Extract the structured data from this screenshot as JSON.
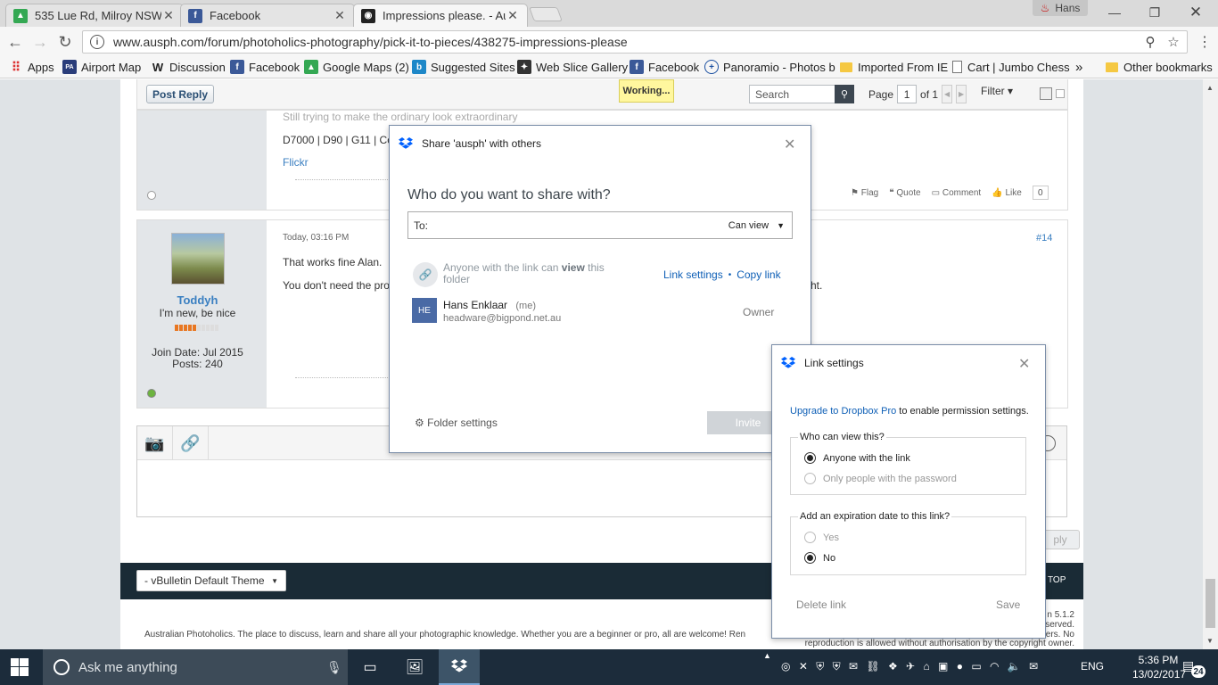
{
  "browser": {
    "tabs": [
      {
        "title": "535 Lue Rd, Milroy NSW",
        "favicon": "google-maps-icon"
      },
      {
        "title": "Facebook",
        "favicon": "facebook-icon"
      },
      {
        "title": "Impressions please. - Aus",
        "favicon": "ausph-icon"
      }
    ],
    "profile_name": "Hans",
    "url": "www.ausph.com/forum/photoholics-photography/pick-it-to-pieces/438275-impressions-please",
    "bookmarks": [
      "Apps",
      "Airport Map",
      "Discussion",
      "Facebook",
      "Google Maps (2)",
      "Suggested Sites",
      "Web Slice Gallery",
      "Facebook",
      "Panoramio - Photos b",
      "Imported From IE",
      "Cart | Jumbo Chess"
    ],
    "overflow": "»",
    "other_bookmarks": "Other bookmarks"
  },
  "forum": {
    "post_reply": "Post Reply",
    "working": "Working...",
    "search_placeholder": "Search",
    "page_label": "Page",
    "page_num": "1",
    "page_of": "of 1",
    "filter": "Filter",
    "post1": {
      "sig_faint": "Still trying to make the ordinary look extraordinary",
      "gear": "D7000 | D90 | G11 | Co",
      "flickr": "Flickr",
      "actions": [
        "Flag",
        "Quote",
        "Comment",
        "Like"
      ],
      "like_count": "0"
    },
    "post2": {
      "date": "Today, 03:16 PM",
      "number": "#14",
      "username": "Toddyh",
      "title": "I'm new, be nice",
      "join": "Join Date: Jul 2015",
      "posts": "Posts: 240",
      "line1": "That works fine Alan.",
      "line2_start": "You don't need the pro",
      "line2_end": "ht."
    },
    "reply_ghost": "ply",
    "theme": "- vBulletin Default Theme",
    "top": "TOP",
    "footer": "Australian Photoholics. The place to discuss, learn and share all your photographic knowledge. Whether you are a beginner or pro, all are welcome! Ren",
    "copyright_lines": [
      "n 5.1.2",
      "served.",
      "ers. No",
      "reproduction is allowed without authorisation by the copyright owner."
    ]
  },
  "share_dialog": {
    "title": "Share 'ausph' with others",
    "question": "Who do you want to share with?",
    "to_label": "To:",
    "permission": "Can view",
    "anyone_pre": "Anyone with the link can",
    "anyone_bold": "view",
    "anyone_post": "this folder",
    "link_settings": "Link settings",
    "separator": "•",
    "copy_link": "Copy link",
    "owner_initials": "HE",
    "owner_name": "Hans Enklaar",
    "owner_me": "(me)",
    "owner_email": "headware@bigpond.net.au",
    "owner_role": "Owner",
    "folder_settings": "Folder settings",
    "invite": "Invite"
  },
  "link_settings_dialog": {
    "title": "Link settings",
    "upgrade_link": "Upgrade to Dropbox Pro",
    "upgrade_rest": " to enable permission settings.",
    "who_legend": "Who can view this?",
    "opt_anyone": "Anyone with the link",
    "opt_password": "Only people with the password",
    "expiry_legend": "Add an expiration date to this link?",
    "opt_yes": "Yes",
    "opt_no": "No",
    "delete": "Delete link",
    "save": "Save"
  },
  "taskbar": {
    "search": "Ask me anything",
    "lang": "ENG",
    "time": "5:36 PM",
    "date": "13/02/2017",
    "notif_count": "24"
  },
  "colors": {
    "dropbox_blue": "#0061fe",
    "link_blue": "#0e5fb6",
    "username_blue": "#3a7fc1",
    "footer_dark": "#1a2b36",
    "taskbar": "#1c2c3b"
  }
}
